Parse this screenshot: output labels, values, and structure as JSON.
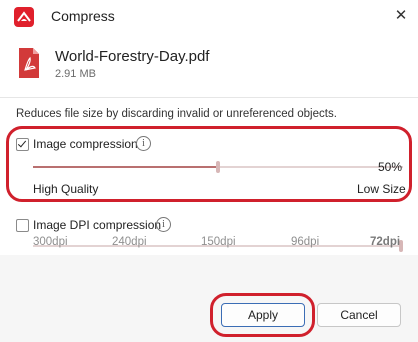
{
  "window": {
    "title": "Compress",
    "accent_color": "#e0202c",
    "close_glyph": "✕"
  },
  "file": {
    "name": "World-Forestry-Day.pdf",
    "size": "2.91 MB",
    "icon": "pdf-file-icon"
  },
  "description": "Reduces file size by discarding invalid or unreferenced objects.",
  "image_compression": {
    "label": "Image compression",
    "checked": true,
    "value_percent": 50,
    "value_label": "50%",
    "left_label": "High Quality",
    "right_label": "Low Size"
  },
  "dpi_compression": {
    "label": "Image DPI compression",
    "checked": false,
    "ticks": [
      "300dpi",
      "240dpi",
      "150dpi",
      "96dpi",
      "72dpi"
    ],
    "selected": "72dpi"
  },
  "buttons": {
    "apply": "Apply",
    "cancel": "Cancel"
  },
  "highlight_color": "#d0202c"
}
